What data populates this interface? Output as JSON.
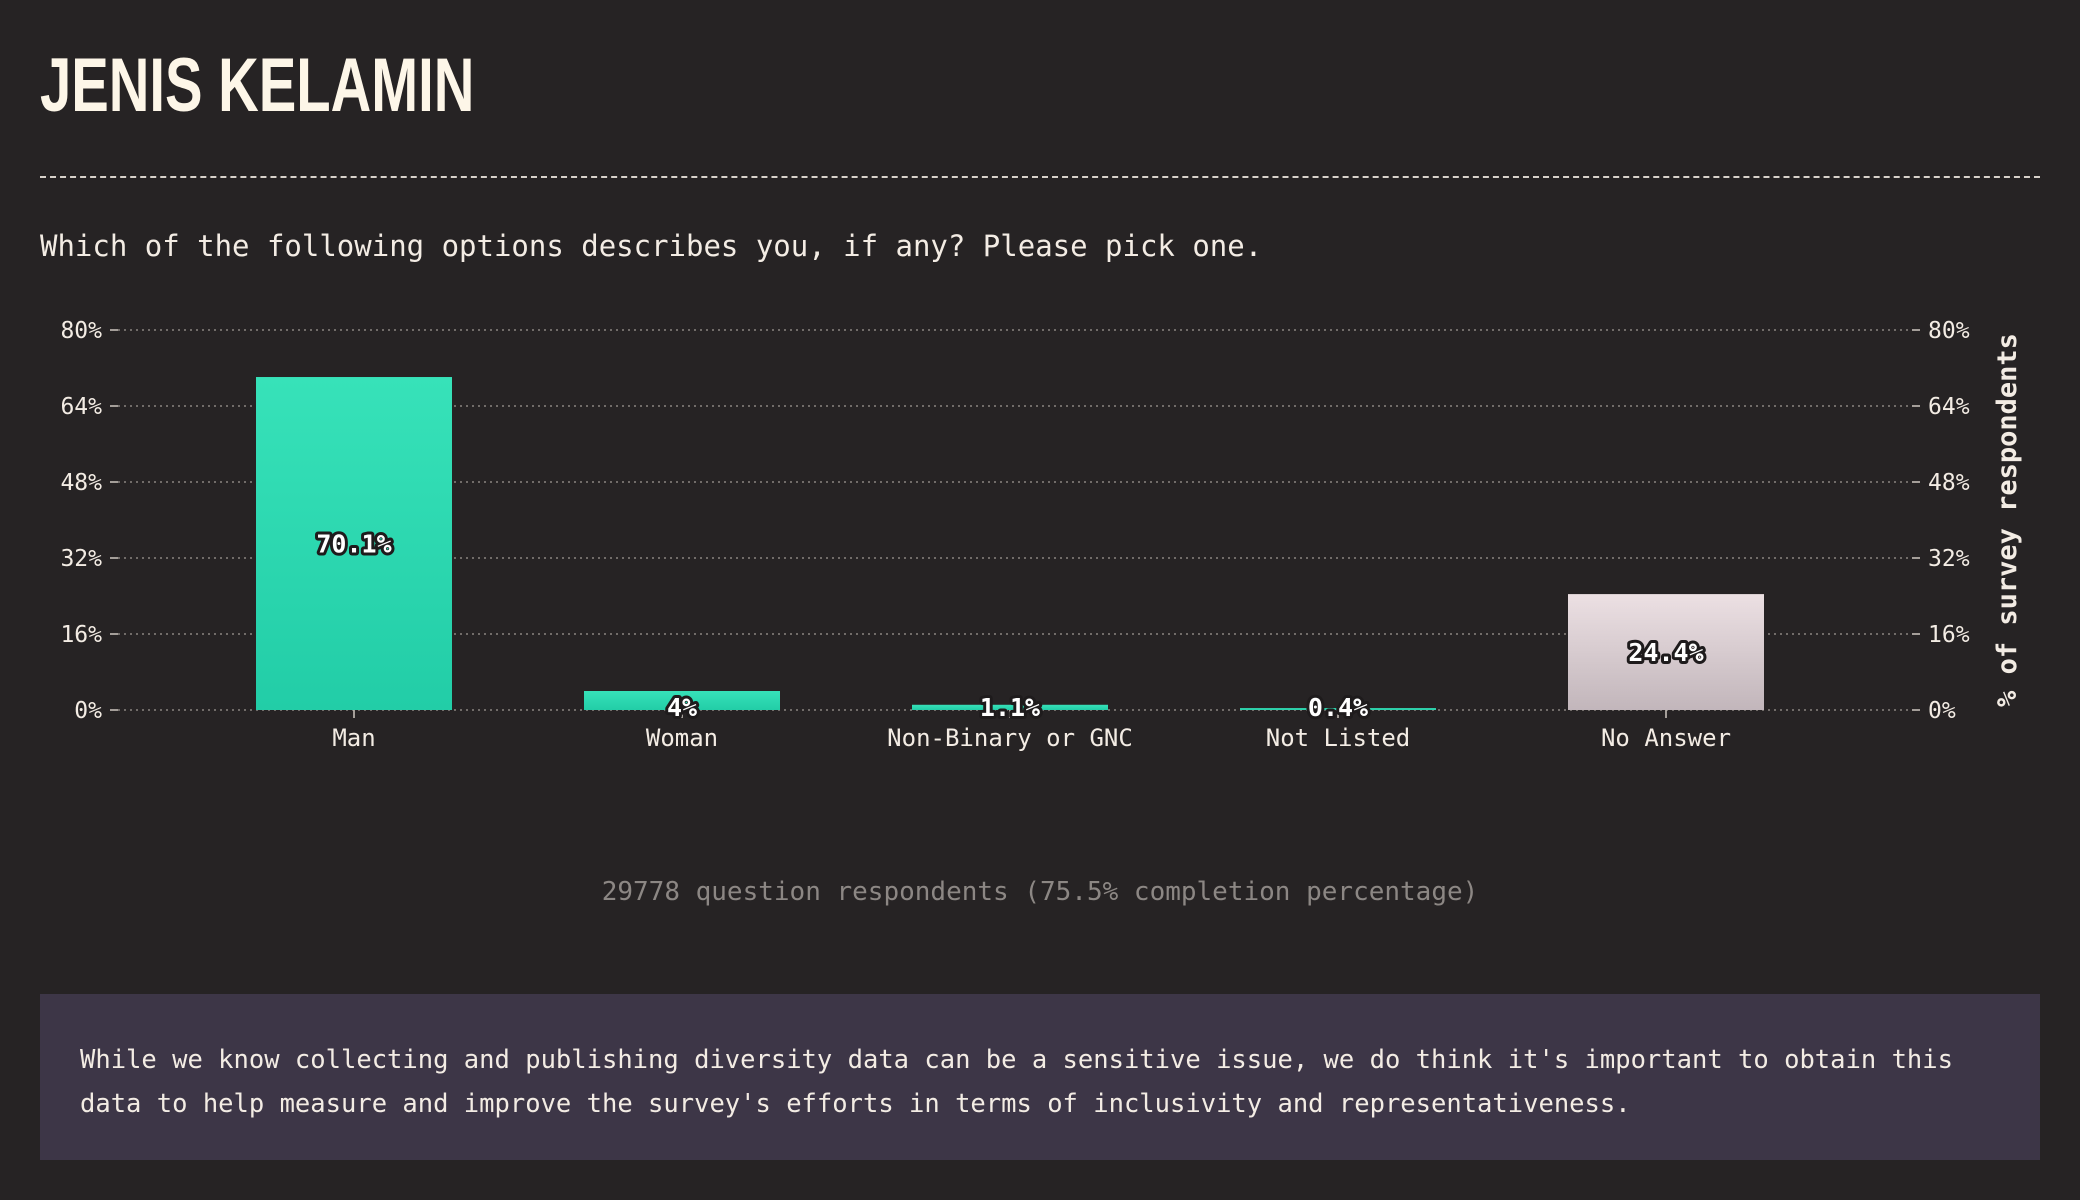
{
  "header": {
    "title": "JENIS KELAMIN"
  },
  "question": {
    "text": "Which of the following options describes you, if any? Please pick one."
  },
  "chart_data": {
    "type": "bar",
    "categories": [
      "Man",
      "Woman",
      "Non-Binary or GNC",
      "Not Listed",
      "No Answer"
    ],
    "values": [
      70.1,
      4.0,
      1.1,
      0.4,
      24.4
    ],
    "value_labels": [
      "70.1%",
      "4%",
      "1.1%",
      "0.4%",
      "24.4%"
    ],
    "ylim": [
      0,
      80
    ],
    "yticks": [
      0,
      16,
      32,
      48,
      64,
      80
    ],
    "ytick_labels": [
      "0%",
      "16%",
      "32%",
      "48%",
      "64%",
      "80%"
    ],
    "ylabel": "% of survey respondents",
    "xlabel": "",
    "grid": true,
    "axis_right": true,
    "colors": {
      "bar_top": "#37e2b9",
      "bar_bottom": "#22cda7",
      "no_answer_top": "#ece0e3",
      "no_answer_bottom": "#c2b6bb",
      "grid": "#8a8480"
    }
  },
  "footer": {
    "respondents": "29778 question respondents (75.5% completion percentage)"
  },
  "note": {
    "text": "While we know collecting and publishing diversity data can be a sensitive issue, we do think it's important to obtain this data to help measure and improve the survey's efforts in terms of inclusivity and representativeness."
  }
}
